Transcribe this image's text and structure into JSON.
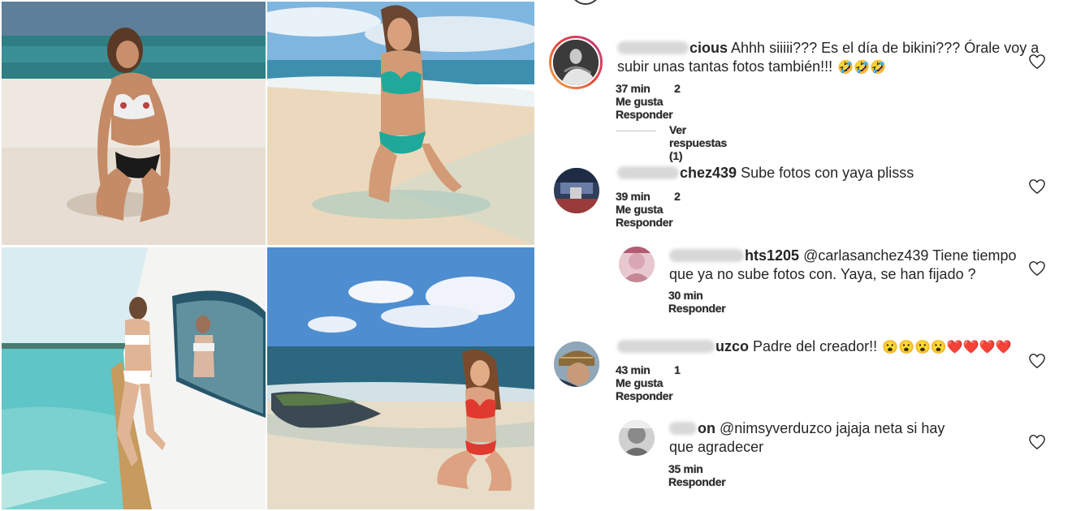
{
  "comments": [
    {
      "user": "cious",
      "text": "Ahhh siiiii??? Es el día de bikini??? Órale voy a",
      "text2": "subir unas tantas fotos también!!!",
      "emoji": "🤣🤣🤣",
      "time": "37 min",
      "likes": "2 Me gusta",
      "reply": "Responder",
      "view_replies": "Ver respuestas (1)"
    },
    {
      "user": "chez439",
      "text": "Sube fotos con yaya plisss",
      "time": "39 min",
      "likes": "2 Me gusta",
      "reply": "Responder"
    },
    {
      "user": "hts1205",
      "text": "@carlasanchez439 Tiene tiempo",
      "text2": "que ya no sube fotos con. Yaya, se han fijado ?",
      "time": "30 min",
      "reply": "Responder"
    },
    {
      "user": "uzco",
      "text": "Padre del creador!!",
      "emoji": "😮😮😮😮❤️❤️❤️❤️",
      "time": "43 min",
      "likes": "1 Me gusta",
      "reply": "Responder"
    },
    {
      "user": "on",
      "text": "@nimsyverduzco jajaja neta si hay",
      "text2": "que agradecer",
      "time": "35 min",
      "reply": "Responder"
    }
  ],
  "icons": {
    "like": "heart-outline-icon"
  },
  "colors": {
    "text": "#262626",
    "story_ring_start": "#f5b041",
    "story_ring_end": "#c13584"
  }
}
